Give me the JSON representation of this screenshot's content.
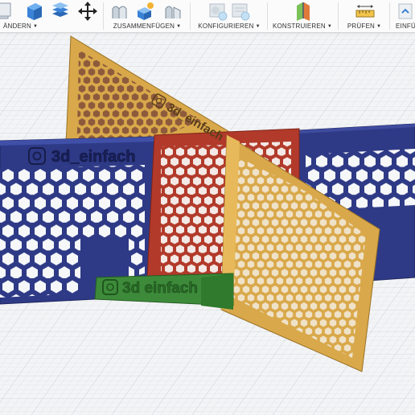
{
  "toolbar": {
    "groups": [
      {
        "label": "ÄNDERN",
        "icons": [
          "sculpt-box-icon",
          "extrude-cube-icon",
          "layer-stack-icon",
          "move-arrows-icon"
        ]
      },
      {
        "label": "ZUSAMMENFÜGEN",
        "icons": [
          "new-component-icon",
          "joint-icon",
          "as-built-joint-icon"
        ]
      },
      {
        "label": "KONFIGURIEREN",
        "icons": [
          "configure-table-icon",
          "configure-rules-icon"
        ]
      },
      {
        "label": "KONSTRUIEREN",
        "icons": [
          "offset-plane-icon"
        ]
      },
      {
        "label": "PRÜFEN",
        "icons": [
          "measure-icon"
        ]
      },
      {
        "label": "EINFÜ"
      }
    ]
  },
  "scene": {
    "engraved_text": [
      "3d_einfach",
      "3d_einfach",
      "3d einfach"
    ],
    "colors": {
      "blue_panel": "#2e3a86",
      "red_panel": "#b23a2a",
      "yellow_panel": "#d9a84a",
      "green_base": "#3d8b3a",
      "hole": "#f6f7f9"
    }
  }
}
